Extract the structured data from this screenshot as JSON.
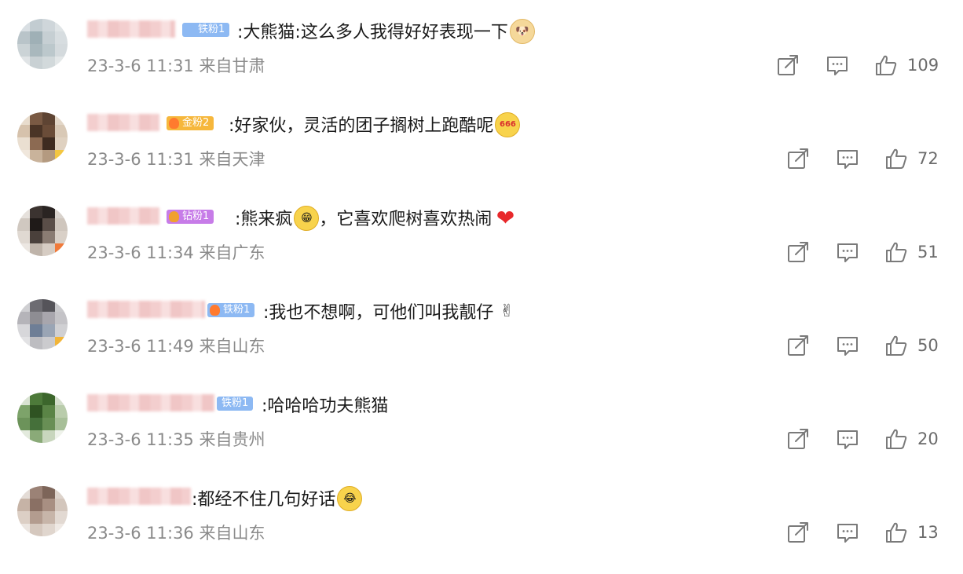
{
  "comments": [
    {
      "badge": "铁粉1",
      "text": ":大熊猫:这么多人我得好好表现一下",
      "emoji": "doge-emoji",
      "time": "23-3-6 11:31",
      "location": "来自甘肃",
      "likes": "109"
    },
    {
      "badge": "金粉2",
      "text": ":好家伙，灵活的团子搁树上跑酷呢",
      "emoji": "666-emoji",
      "time": "23-3-6 11:31",
      "location": "来自天津",
      "likes": "72"
    },
    {
      "badge": "钻粉1",
      "text": ":熊来疯",
      "text2": "，它喜欢爬树喜欢热闹",
      "emoji": "grin-emoji",
      "emoji2": "heart-emoji",
      "time": "23-3-6 11:34",
      "location": "来自广东",
      "likes": "51"
    },
    {
      "badge": "铁粉1",
      "text": ":我也不想啊，可他们叫我靓仔",
      "emoji": "victory-hand-emoji",
      "emoji_glyph": "✌",
      "time": "23-3-6 11:49",
      "location": "来自山东",
      "likes": "50"
    },
    {
      "badge": "铁粉1",
      "text": ":哈哈哈功夫熊猫",
      "time": "23-3-6 11:35",
      "location": "来自贵州",
      "likes": "20"
    },
    {
      "text": ":都经不住几句好话",
      "emoji": "laugh-cry-emoji",
      "time": "23-3-6 11:36",
      "location": "来自山东",
      "likes": "13"
    }
  ],
  "colors": {
    "badge_iron": "#7fb2f0",
    "badge_gold": "#f6b73c",
    "badge_diamond": "#c77ce8",
    "meta_text": "#8a8a8a",
    "icon_gray": "#7a7a7a"
  }
}
